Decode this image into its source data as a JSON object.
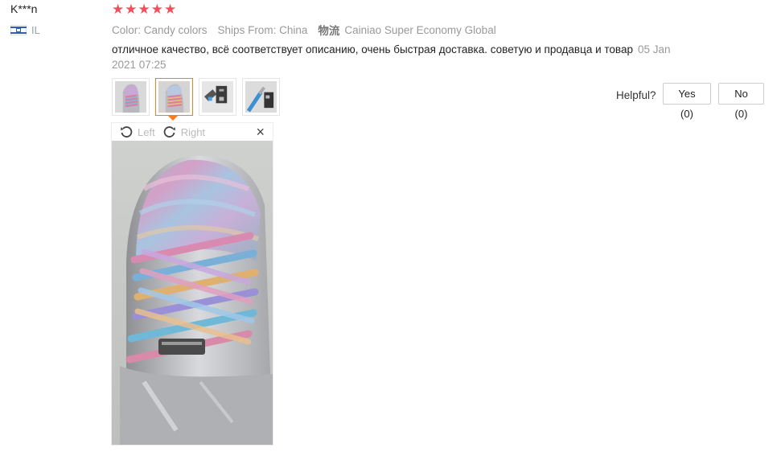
{
  "user": {
    "name": "K***n",
    "country_code": "IL",
    "flag_icon": "israel-flag-icon"
  },
  "rating": {
    "stars": 5,
    "max": 5,
    "color": "#f0505a"
  },
  "attributes": {
    "color": "Color: Candy colors",
    "ships_from": "Ships From: China",
    "logistics_label": "物流",
    "logistics_value": "Cainiao Super Economy Global"
  },
  "review": {
    "text": "отличное качество, всё соответствует описанию, очень быстрая доставка. советую и продавца и товар",
    "date": "05 Jan 2021 07:25"
  },
  "thumbnails": [
    {
      "name": "photo-1",
      "selected": false
    },
    {
      "name": "photo-2",
      "selected": true
    },
    {
      "name": "photo-3",
      "selected": false
    },
    {
      "name": "photo-4",
      "selected": false
    }
  ],
  "viewer": {
    "left_label": "Left",
    "right_label": "Right",
    "close_glyph": "×"
  },
  "helpful": {
    "label": "Helpful?",
    "yes": "Yes (0)",
    "no": "No (0)"
  },
  "colors": {
    "accent": "#ff7a1a",
    "muted": "#999999"
  }
}
